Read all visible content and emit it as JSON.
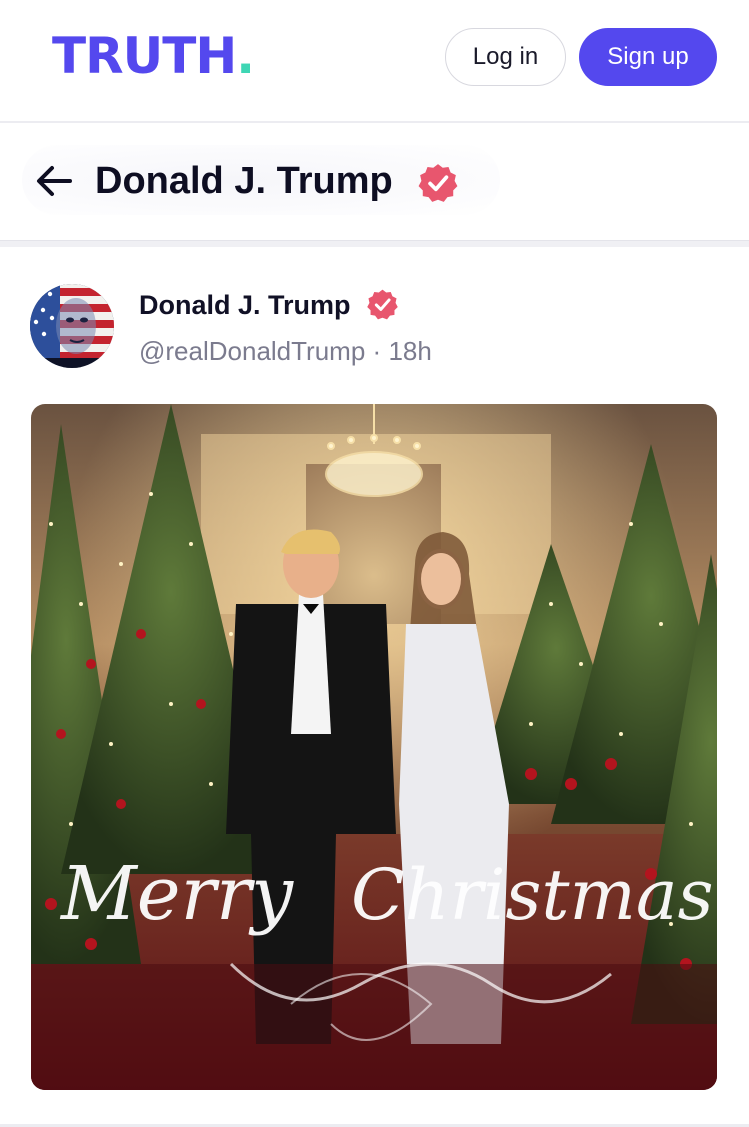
{
  "header": {
    "logo_text": "TRUTH",
    "logo_dot": ".",
    "login_label": "Log in",
    "signup_label": "Sign up",
    "brand_color": "#5448ee",
    "accent_color": "#3ed6b4"
  },
  "titlebar": {
    "back_icon": "arrow-left-icon",
    "title": "Donald J. Trump",
    "badge_icon": "verified-badge-icon",
    "badge_color": "#e8566e"
  },
  "post": {
    "author_name": "Donald J. Trump",
    "handle": "@realDonaldTrump",
    "separator": "·",
    "time": "18h",
    "image_caption_line1": "Merry",
    "image_caption_line2": "Christmas"
  }
}
